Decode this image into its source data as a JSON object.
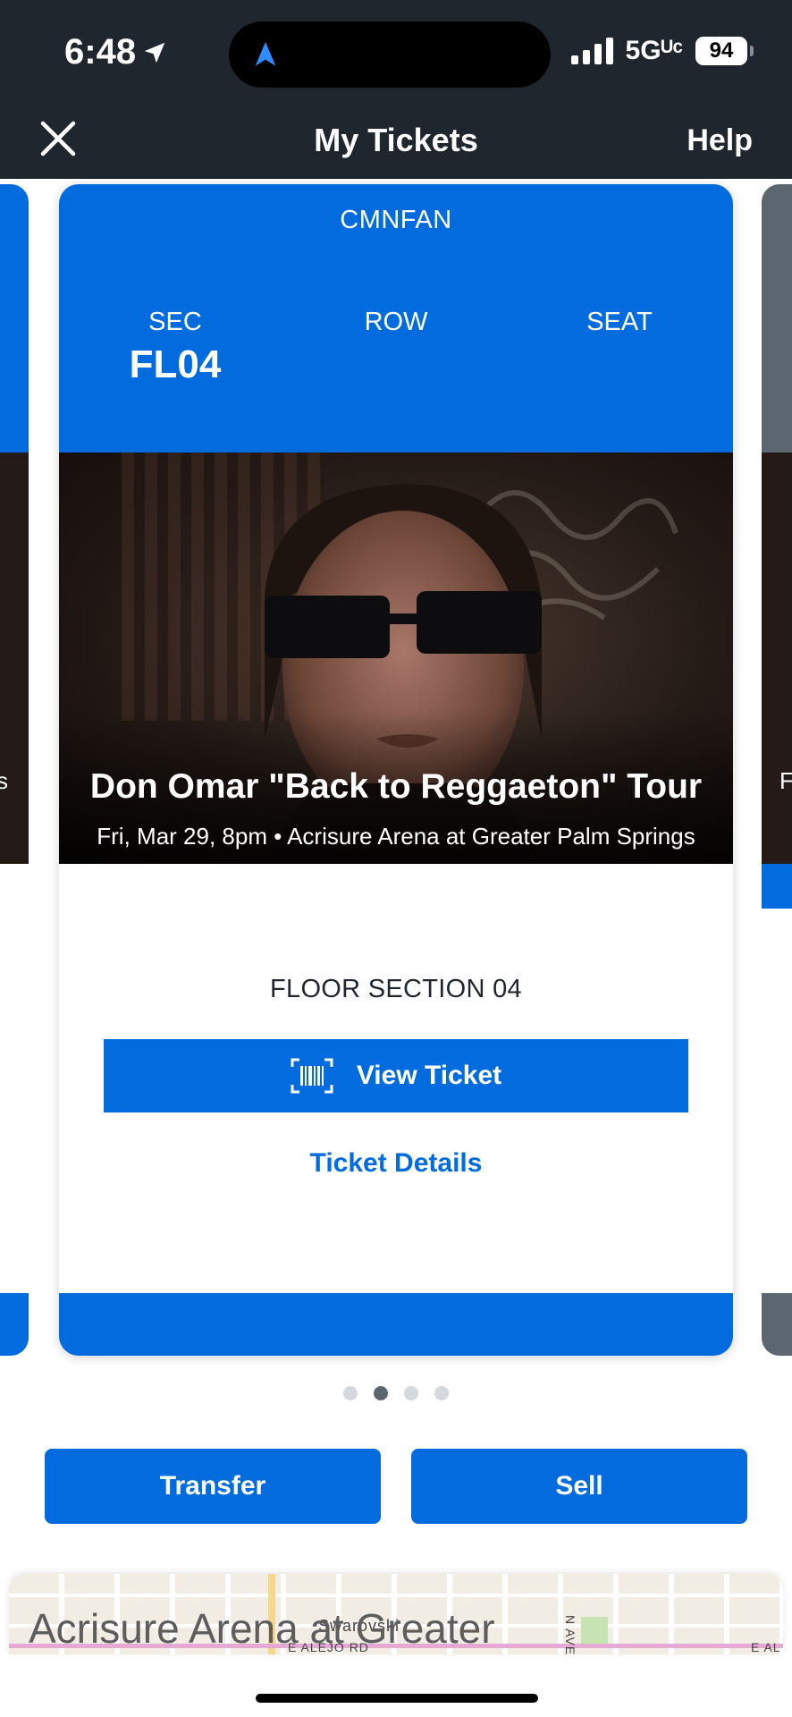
{
  "status_bar": {
    "time": "6:48",
    "network": "5Gᵁᶜ",
    "battery": "94"
  },
  "nav": {
    "title": "My Tickets",
    "help_label": "Help"
  },
  "ticket": {
    "ticket_type": "CMNFAN",
    "sec_label": "SEC",
    "sec_value": "FL04",
    "row_label": "ROW",
    "row_value": "",
    "seat_label": "SEAT",
    "seat_value": "",
    "event_title": "Don Omar \"Back to Reggaeton\" Tour",
    "event_subtitle": "Fri, Mar 29, 8pm • Acrisure Arena at Greater Palm Springs",
    "section_name": "FLOOR SECTION 04",
    "view_ticket_label": "View Ticket",
    "details_label": "Ticket Details"
  },
  "side_cards": {
    "left_fragment": "s",
    "right_fragment": "F"
  },
  "pager": {
    "total": 4,
    "active_index": 1
  },
  "actions": {
    "transfer_label": "Transfer",
    "sell_label": "Sell"
  },
  "map": {
    "title": "Acrisure Arena at Greater",
    "label_street1": "E ALEJO RD",
    "label_street2": "N AVE",
    "label_street3": "E AL",
    "label_place": "Swarovski"
  },
  "colors": {
    "brand_blue": "#026cdf",
    "header_dark": "#1f262d",
    "side_gray": "#5b6670"
  }
}
